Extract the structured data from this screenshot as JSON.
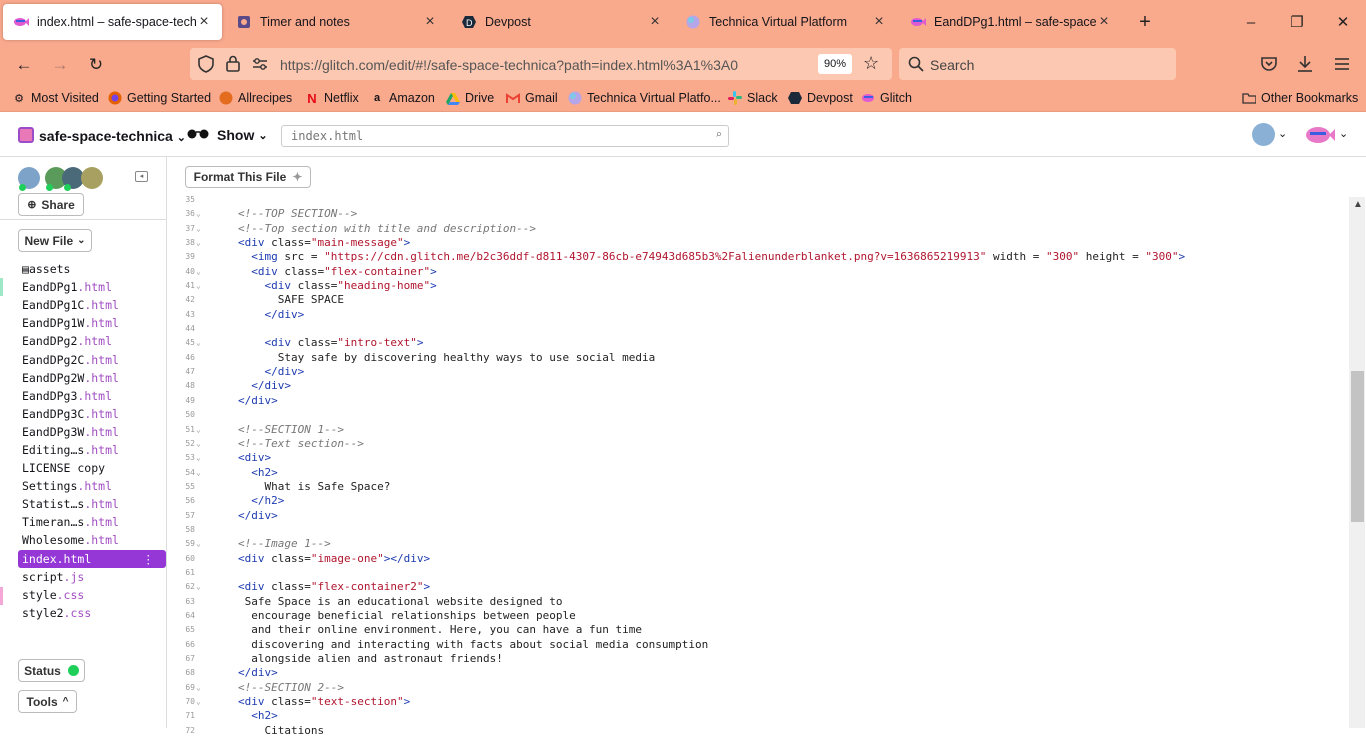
{
  "tabs": [
    {
      "title": "index.html – safe-space-technic",
      "active": true,
      "favicon": "glitch-fish-icon"
    },
    {
      "title": "Timer and notes",
      "active": false,
      "favicon": "puzzle-icon"
    },
    {
      "title": "Devpost",
      "active": false,
      "favicon": "devpost-icon"
    },
    {
      "title": "Technica Virtual Platform",
      "active": false,
      "favicon": "technica-icon"
    },
    {
      "title": "EandDPg1.html – safe-space-te",
      "active": false,
      "favicon": "glitch-fish-icon"
    }
  ],
  "window": {
    "minimize": "–",
    "maximize": "❐",
    "close": "✕",
    "new_tab": "+"
  },
  "nav": {
    "url": "https://glitch.com/edit/#!/safe-space-technica?path=index.html%3A1%3A0",
    "zoom": "90%",
    "search_placeholder": "Search"
  },
  "bookmarks": [
    "Most Visited",
    "Getting Started",
    "Allrecipes",
    "Netflix",
    "Amazon",
    "Drive",
    "Gmail",
    "Technica Virtual Platfo...",
    "Slack",
    "Devpost",
    "Glitch"
  ],
  "other_bookmarks": "Other Bookmarks",
  "glitch": {
    "project": "safe-space-technica",
    "show": "Show",
    "file_search": "index.html"
  },
  "sidebar": {
    "share": "Share",
    "new_file": "New File",
    "status": "Status",
    "tools": "Tools",
    "files": [
      {
        "name": "assets",
        "ext": ""
      },
      {
        "name": "EandDPg1",
        "ext": ".html"
      },
      {
        "name": "EandDPg1C",
        "ext": ".html"
      },
      {
        "name": "EandDPg1W",
        "ext": ".html"
      },
      {
        "name": "EandDPg2",
        "ext": ".html"
      },
      {
        "name": "EandDPg2C",
        "ext": ".html"
      },
      {
        "name": "EandDPg2W",
        "ext": ".html"
      },
      {
        "name": "EandDPg3",
        "ext": ".html"
      },
      {
        "name": "EandDPg3C",
        "ext": ".html"
      },
      {
        "name": "EandDPg3W",
        "ext": ".html"
      },
      {
        "name": "Editing…s",
        "ext": ".html"
      },
      {
        "name": "LICENSE copy",
        "ext": ""
      },
      {
        "name": "Settings",
        "ext": ".html"
      },
      {
        "name": "Statist…s",
        "ext": ".html"
      },
      {
        "name": "Timeran…s",
        "ext": ".html"
      },
      {
        "name": "Wholesome",
        "ext": ".html"
      },
      {
        "name": "index",
        "ext": ".html"
      },
      {
        "name": "script",
        "ext": ".js"
      },
      {
        "name": "style",
        "ext": ".css"
      },
      {
        "name": "style2",
        "ext": ".css"
      }
    ]
  },
  "editor": {
    "format_button": "Format This File",
    "lines": [
      {
        "n": "35",
        "fold": "",
        "html": ""
      },
      {
        "n": "36",
        "fold": "⌄",
        "html": "<span class='cmt'>&lt;!--TOP SECTION--&gt;</span>"
      },
      {
        "n": "37",
        "fold": "⌄",
        "html": "<span class='cmt'>&lt;!--Top section with title and description--&gt;</span>"
      },
      {
        "n": "38",
        "fold": "⌄",
        "html": "<span class='tag'>&lt;div</span> class=<span class='str'>\"main-message\"</span><span class='tag'>&gt;</span>"
      },
      {
        "n": "39",
        "fold": "",
        "html": "  <span class='tag'>&lt;img</span> src = <span class='str'>\"https://cdn.glitch.me/b2c36ddf-d811-4307-86cb-e74943d685b3%2Falienunderblanket.png?v=1636865219913\"</span> width = <span class='str'>\"300\"</span> height = <span class='str'>\"300\"</span><span class='tag'>&gt;</span>"
      },
      {
        "n": "40",
        "fold": "⌄",
        "html": "  <span class='tag'>&lt;div</span> class=<span class='str'>\"flex-container\"</span><span class='tag'>&gt;</span>"
      },
      {
        "n": "41",
        "fold": "⌄",
        "html": "    <span class='tag'>&lt;div</span> class=<span class='str'>\"heading-home\"</span><span class='tag'>&gt;</span>"
      },
      {
        "n": "42",
        "fold": "",
        "html": "      SAFE SPACE"
      },
      {
        "n": "43",
        "fold": "",
        "html": "    <span class='tag'>&lt;/div&gt;</span>"
      },
      {
        "n": "44",
        "fold": "",
        "html": ""
      },
      {
        "n": "45",
        "fold": "⌄",
        "html": "    <span class='tag'>&lt;div</span> class=<span class='str'>\"intro-text\"</span><span class='tag'>&gt;</span>"
      },
      {
        "n": "46",
        "fold": "",
        "html": "      Stay safe by discovering healthy ways to use social media"
      },
      {
        "n": "47",
        "fold": "",
        "html": "    <span class='tag'>&lt;/div&gt;</span>"
      },
      {
        "n": "48",
        "fold": "",
        "html": "  <span class='tag'>&lt;/div&gt;</span>"
      },
      {
        "n": "49",
        "fold": "",
        "html": "<span class='tag'>&lt;/div&gt;</span>"
      },
      {
        "n": "50",
        "fold": "",
        "html": ""
      },
      {
        "n": "51",
        "fold": "⌄",
        "html": "<span class='cmt'>&lt;!--SECTION 1--&gt;</span>"
      },
      {
        "n": "52",
        "fold": "⌄",
        "html": "<span class='cmt'>&lt;!--Text section--&gt;</span>"
      },
      {
        "n": "53",
        "fold": "⌄",
        "html": "<span class='tag'>&lt;div&gt;</span>"
      },
      {
        "n": "54",
        "fold": "⌄",
        "html": "  <span class='tag'>&lt;h2&gt;</span>"
      },
      {
        "n": "55",
        "fold": "",
        "html": "    What is Safe Space?"
      },
      {
        "n": "56",
        "fold": "",
        "html": "  <span class='tag'>&lt;/h2&gt;</span>"
      },
      {
        "n": "57",
        "fold": "",
        "html": "<span class='tag'>&lt;/div&gt;</span>"
      },
      {
        "n": "58",
        "fold": "",
        "html": ""
      },
      {
        "n": "59",
        "fold": "⌄",
        "html": "<span class='cmt'>&lt;!--Image 1--&gt;</span>"
      },
      {
        "n": "60",
        "fold": "",
        "html": "<span class='tag'>&lt;div</span> class=<span class='str'>\"image-one\"</span><span class='tag'>&gt;&lt;/div&gt;</span>"
      },
      {
        "n": "61",
        "fold": "",
        "html": ""
      },
      {
        "n": "62",
        "fold": "⌄",
        "html": "<span class='tag'>&lt;div</span> class=<span class='str'>\"flex-container2\"</span><span class='tag'>&gt;</span>"
      },
      {
        "n": "63",
        "fold": "",
        "html": " Safe Space is an educational website designed to"
      },
      {
        "n": "64",
        "fold": "",
        "html": "  encourage beneficial relationships between people"
      },
      {
        "n": "65",
        "fold": "",
        "html": "  and their online environment. Here, you can have a fun time"
      },
      {
        "n": "66",
        "fold": "",
        "html": "  discovering and interacting with facts about social media consumption"
      },
      {
        "n": "67",
        "fold": "",
        "html": "  alongside alien and astronaut friends!"
      },
      {
        "n": "68",
        "fold": "",
        "html": "<span class='tag'>&lt;/div&gt;</span>"
      },
      {
        "n": "69",
        "fold": "⌄",
        "html": "<span class='cmt'>&lt;!--SECTION 2--&gt;</span>"
      },
      {
        "n": "70",
        "fold": "⌄",
        "html": "<span class='tag'>&lt;div</span> class=<span class='str'>\"text-section\"</span><span class='tag'>&gt;</span>"
      },
      {
        "n": "71",
        "fold": "",
        "html": "  <span class='tag'>&lt;h2&gt;</span>"
      },
      {
        "n": "72",
        "fold": "",
        "html": "    Citations"
      }
    ]
  }
}
